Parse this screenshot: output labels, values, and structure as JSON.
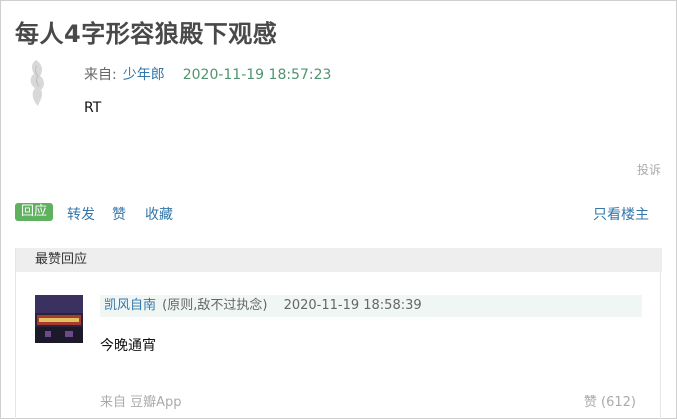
{
  "topic": {
    "title": "每人4字形容狼殿下观感",
    "from_label": "来自:",
    "author": "少年郎",
    "time": "2020-11-19 18:57:23",
    "content": "RT",
    "report_label": "投诉"
  },
  "actions": {
    "reply": "回应",
    "repost": "转发",
    "like": "赞",
    "collect": "收藏",
    "only_op": "只看楼主"
  },
  "best_replies": {
    "header": "最赞回应",
    "items": [
      {
        "author": "凯风自南",
        "signature": "(原则,敌不过执念)",
        "time": "2020-11-19 18:58:39",
        "text": "今晚通宵",
        "source": "来自 豆瓣App",
        "like": "赞 (612)"
      }
    ]
  },
  "colors": {
    "link": "#3377aa",
    "time_green": "#4f946e",
    "reply_button_bg": "#5fb05f",
    "header_bg": "#eeeeee"
  }
}
